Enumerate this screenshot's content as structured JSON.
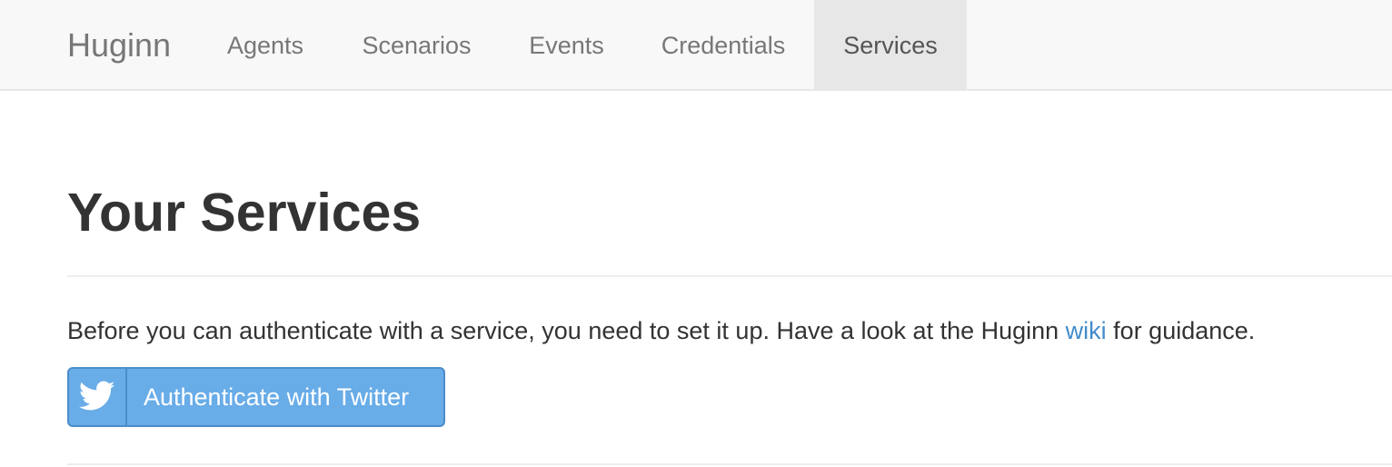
{
  "navbar": {
    "brand": "Huginn",
    "items": [
      {
        "label": "Agents",
        "active": false
      },
      {
        "label": "Scenarios",
        "active": false
      },
      {
        "label": "Events",
        "active": false
      },
      {
        "label": "Credentials",
        "active": false
      },
      {
        "label": "Services",
        "active": true
      }
    ]
  },
  "main": {
    "title": "Your Services",
    "intro_before": "Before you can authenticate with a service, you need to set it up. Have a look at the Huginn ",
    "intro_link": "wiki",
    "intro_after": " for guidance.",
    "twitter_button": {
      "label": "Authenticate with Twitter",
      "icon": "twitter-icon"
    }
  },
  "colors": {
    "navbar_bg": "#f8f8f8",
    "nav_active_bg": "#e7e7e7",
    "link": "#428bca",
    "twitter_button_bg": "#68ace8",
    "twitter_button_border": "#4c8dc9"
  }
}
